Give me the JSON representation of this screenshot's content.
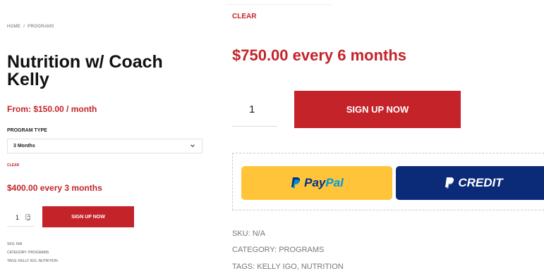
{
  "breadcrumb": {
    "home": "HOME",
    "separator": "/",
    "current": "PROGRAMS"
  },
  "product": {
    "title": "Nutrition w/ Coach Kelly",
    "from_price": "From: $150.00 / month",
    "program_type_label": "PROGRAM TYPE",
    "program_type_selected": "3 Months",
    "clear_label": "CLEAR",
    "variation_price": "$400.00 every 3 months",
    "quantity": "1",
    "signup_label": "SIGN UP NOW",
    "sku": "SKU: N/A",
    "category": "CATEGORY: PROGRAMS",
    "tags": "TAGS: KELLY IGO, NUTRITION"
  },
  "zoomed": {
    "clear_label": "CLEAR",
    "variation_price": "$750.00 every 6 months",
    "quantity": "1",
    "signup_label": "SIGN UP NOW",
    "paypal_label_1": "Pay",
    "paypal_label_2": "Pal",
    "credit_label": "CREDIT",
    "sku": "SKU: N/A",
    "category": "CATEGORY: PROGRAMS",
    "tags": "TAGS: KELLY IGO, NUTRITION"
  },
  "icons": {
    "select": "chevron-down-icon",
    "stepper": "stepper-arrows-icon",
    "paypal": "paypal-p-icon",
    "credit": "paypal-p-icon"
  },
  "colors": {
    "brand_red": "#c4232a",
    "paypal_yellow": "#ffc439",
    "paypal_dark_blue": "#003087",
    "paypal_light_blue": "#009cde",
    "credit_navy": "#0b2a78"
  }
}
